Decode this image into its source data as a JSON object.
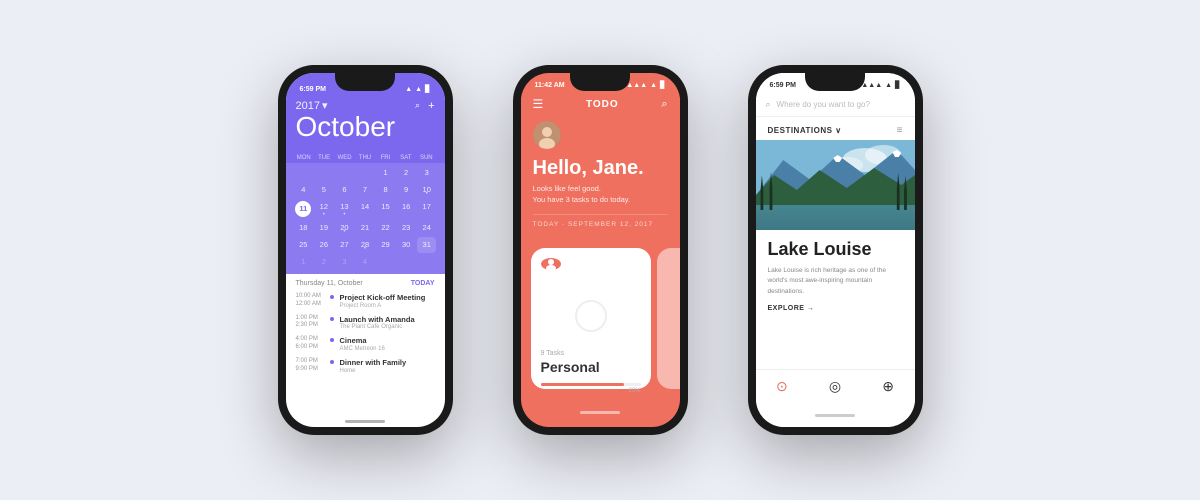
{
  "background": "#eceef5",
  "phones": {
    "phone1": {
      "status": {
        "time": "6:59 PM",
        "signal": "●●●",
        "wifi": "▲",
        "battery": "■"
      },
      "year": "2017",
      "month": "October",
      "dayLabels": [
        "MON",
        "TUE",
        "WED",
        "THU",
        "FRI",
        "SAT",
        "SUN"
      ],
      "weeks": [
        [
          "",
          "",
          "",
          "",
          "1",
          "2",
          "3"
        ],
        [
          "4",
          "5",
          "6",
          "7",
          "8",
          "9",
          "10"
        ],
        [
          "11",
          "12",
          "13",
          "14",
          "15",
          "16",
          "17"
        ],
        [
          "18",
          "19",
          "20",
          "21",
          "22",
          "23",
          "24"
        ],
        [
          "25",
          "26",
          "27",
          "28",
          "29",
          "30",
          "31"
        ],
        [
          "1",
          "2",
          "3",
          "4",
          "",
          "",
          ""
        ]
      ],
      "todayDate": "11",
      "listHeader": {
        "date": "Thursday 11, October",
        "label": "TODAY"
      },
      "events": [
        {
          "start": "10:00 AM",
          "end": "12:00 AM",
          "title": "Project Kick-off Meeting",
          "subtitle": "Project Room A"
        },
        {
          "start": "1:00 PM",
          "end": "2:30 PM",
          "title": "Launch with Amanda",
          "subtitle": "The Plant Cafe Organic"
        },
        {
          "start": "4:00 PM",
          "end": "6:00 PM",
          "title": "Cinema",
          "subtitle": "AMC Metreon 16"
        },
        {
          "start": "7:00 PM",
          "end": "9:00 PM",
          "title": "Dinner with Family",
          "subtitle": "Home"
        }
      ]
    },
    "phone2": {
      "status": {
        "time": "11:42 AM"
      },
      "app_title": "TODO",
      "greeting": "Hello, Jane.",
      "subtitle_line1": "Looks like feel good.",
      "subtitle_line2": "You have 3 tasks to do today.",
      "date_label": "TODAY · SEPTEMBER 12, 2017",
      "card": {
        "tasks_count": "9 Tasks",
        "name": "Personal",
        "progress": 83,
        "progress_label": "83%"
      }
    },
    "phone3": {
      "status": {
        "time": "6:59 PM"
      },
      "search_placeholder": "Where do you want to go?",
      "destinations_label": "DESTINATIONS",
      "place_name": "Lake Louise",
      "description": "Lake Louise is rich heritage as one of the world's most awe-inspiring mountain destinations.",
      "explore_label": "EXPLORE →",
      "nav_icons": [
        "compass",
        "location",
        "user"
      ]
    }
  }
}
